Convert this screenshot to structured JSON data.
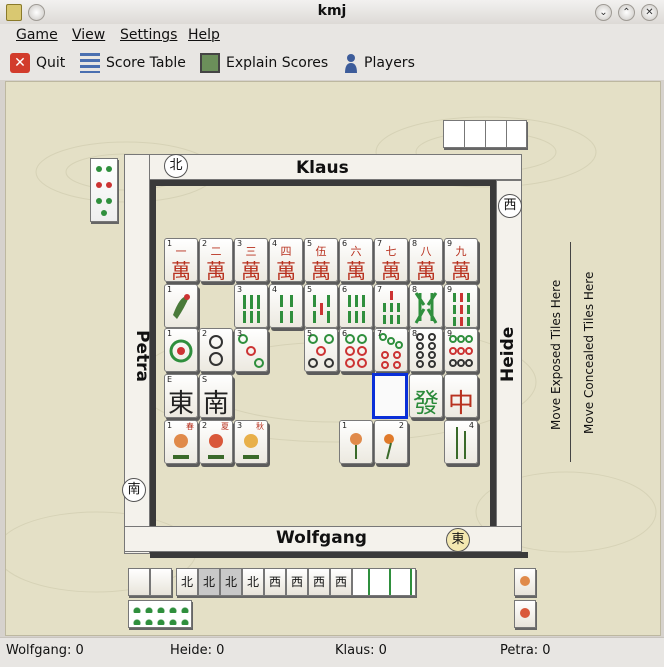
{
  "window": {
    "title": "kmj"
  },
  "menu": {
    "items": [
      "Game",
      "View",
      "Settings",
      "Help"
    ]
  },
  "toolbar": {
    "quit": "Quit",
    "score_table": "Score Table",
    "explain_scores": "Explain Scores",
    "players": "Players"
  },
  "players": {
    "north": "Klaus",
    "west": "Petra",
    "east": "Heide",
    "south": "Wolfgang"
  },
  "side_labels": {
    "exposed": "Move Exposed Tiles Here",
    "concealed": "Move Concealed Tiles Here"
  },
  "tiles": {
    "characters": [
      {
        "num": "1",
        "top": "一"
      },
      {
        "num": "2",
        "top": "二"
      },
      {
        "num": "3",
        "top": "三"
      },
      {
        "num": "4",
        "top": "四"
      },
      {
        "num": "5",
        "top": "伍"
      },
      {
        "num": "6",
        "top": "六"
      },
      {
        "num": "7",
        "top": "七"
      },
      {
        "num": "8",
        "top": "八"
      },
      {
        "num": "9",
        "top": "九"
      }
    ],
    "character_glyph": "萬",
    "winds": [
      {
        "num": "E",
        "glyph": "東"
      },
      {
        "num": "S",
        "glyph": "南"
      }
    ],
    "dragons": [
      "發",
      "中"
    ],
    "flowers_left": [
      {
        "num": "1",
        "char": "春"
      },
      {
        "num": "2",
        "char": "夏"
      },
      {
        "num": "3",
        "char": "秋"
      }
    ],
    "flowers_right": [
      {
        "num": "1"
      },
      {
        "num": "2"
      },
      {
        "num": "4"
      }
    ],
    "bottom_winds": [
      "北",
      "北",
      "北",
      "北",
      "西",
      "西",
      "西",
      "西"
    ],
    "wind_discs": {
      "north": "北",
      "east": "西",
      "west": "南",
      "south": "東"
    }
  },
  "status": {
    "wolfgang": "Wolfgang: 0",
    "heide": "Heide: 0",
    "klaus": "Klaus: 0",
    "petra": "Petra: 0"
  },
  "colors": {
    "board": "#e4e0c6",
    "highlight": "#0a2fd8",
    "char_red": "#b8311f",
    "dragon_green": "#2a8a3a"
  }
}
